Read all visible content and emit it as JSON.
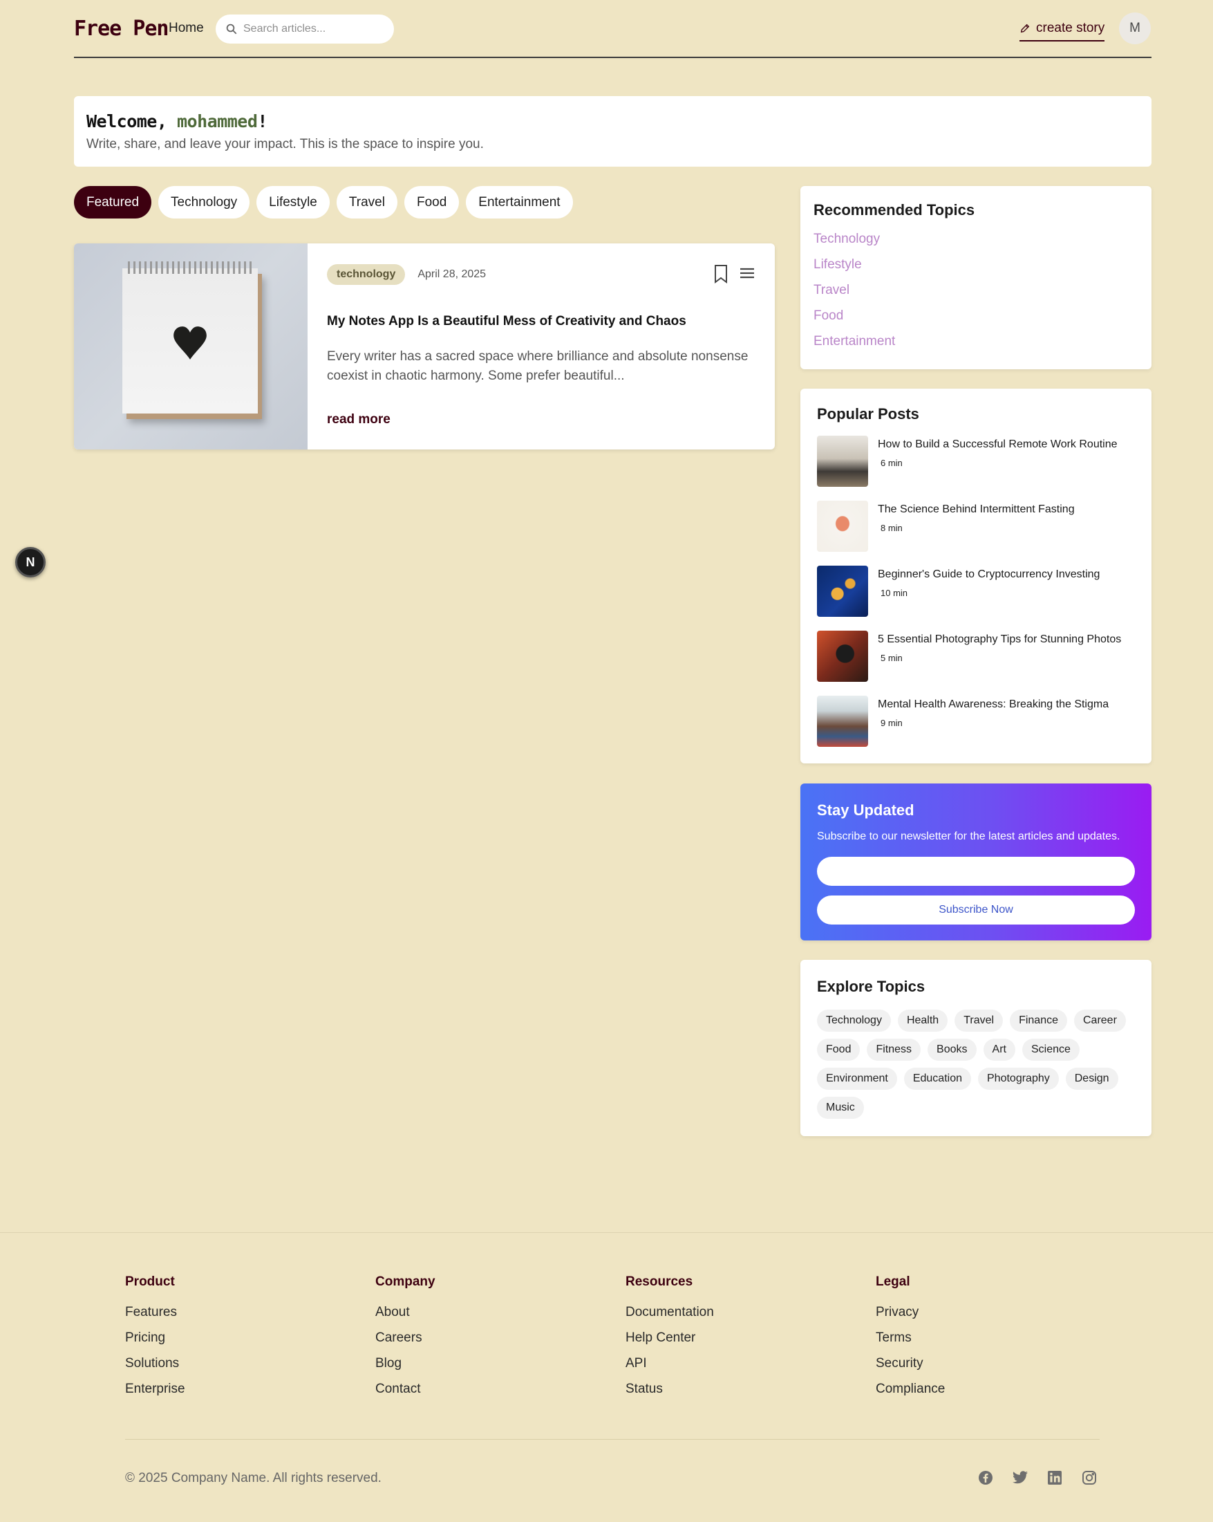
{
  "header": {
    "logo": "Free Pen",
    "home_label": "Home",
    "search_placeholder": "Search articles...",
    "create_story_label": "create story",
    "avatar_initial": "M"
  },
  "welcome": {
    "greeting": "Welcome, ",
    "username": "mohammed",
    "exclamation": "!",
    "subtitle": "Write, share, and leave your impact. This is the space to inspire you."
  },
  "tabs": [
    {
      "label": "Featured",
      "active": true
    },
    {
      "label": "Technology",
      "active": false
    },
    {
      "label": "Lifestyle",
      "active": false
    },
    {
      "label": "Travel",
      "active": false
    },
    {
      "label": "Food",
      "active": false
    },
    {
      "label": "Entertainment",
      "active": false
    }
  ],
  "article": {
    "category": "technology",
    "date": "April 28, 2025",
    "title": "My Notes App Is a Beautiful Mess of Creativity and Chaos",
    "excerpt": "Every writer has a sacred space where brilliance and absolute nonsense coexist in chaotic harmony. Some prefer beautiful...",
    "read_more": "read more"
  },
  "recommended": {
    "title": "Recommended Topics",
    "items": [
      "Technology",
      "Lifestyle",
      "Travel",
      "Food",
      "Entertainment"
    ]
  },
  "popular": {
    "title": "Popular Posts",
    "items": [
      {
        "title": "How to Build a Successful Remote Work Routine",
        "time": "6 min"
      },
      {
        "title": "The Science Behind Intermittent Fasting",
        "time": "8 min"
      },
      {
        "title": "Beginner's Guide to Cryptocurrency Investing",
        "time": "10 min"
      },
      {
        "title": "5 Essential Photography Tips for Stunning Photos",
        "time": "5 min"
      },
      {
        "title": "Mental Health Awareness: Breaking the Stigma",
        "time": "9 min"
      }
    ]
  },
  "newsletter": {
    "title": "Stay Updated",
    "description": "Subscribe to our newsletter for the latest articles and updates.",
    "email_placeholder": "",
    "button_label": "Subscribe Now"
  },
  "explore": {
    "title": "Explore Topics",
    "chips": [
      "Technology",
      "Health",
      "Travel",
      "Finance",
      "Career",
      "Food",
      "Fitness",
      "Books",
      "Art",
      "Science",
      "Environment",
      "Education",
      "Photography",
      "Design",
      "Music"
    ]
  },
  "floating_badge": "N",
  "footer": {
    "columns": [
      {
        "title": "Product",
        "links": [
          "Features",
          "Pricing",
          "Solutions",
          "Enterprise"
        ]
      },
      {
        "title": "Company",
        "links": [
          "About",
          "Careers",
          "Blog",
          "Contact"
        ]
      },
      {
        "title": "Resources",
        "links": [
          "Documentation",
          "Help Center",
          "API",
          "Status"
        ]
      },
      {
        "title": "Legal",
        "links": [
          "Privacy",
          "Terms",
          "Security",
          "Compliance"
        ]
      }
    ],
    "copyright": "© 2025 Company Name. All rights reserved.",
    "social_icons": [
      "facebook-icon",
      "twitter-icon",
      "linkedin-icon",
      "instagram-icon"
    ]
  },
  "colors": {
    "background": "#efe5c3",
    "brand": "#3d0010",
    "topic_link": "#b985c8",
    "newsletter_gradient_start": "#4a73f5",
    "newsletter_gradient_end": "#9a1cf2"
  }
}
